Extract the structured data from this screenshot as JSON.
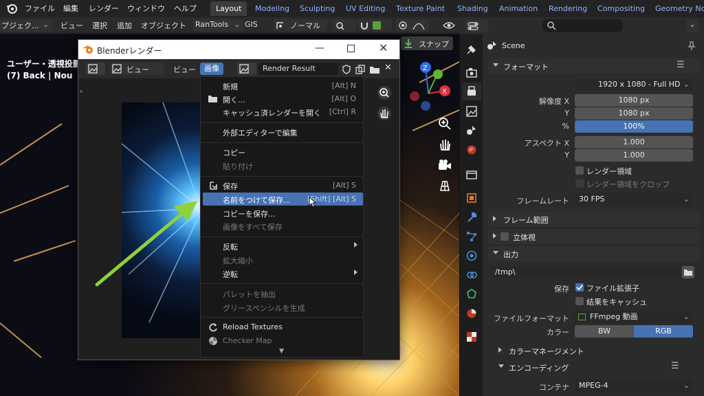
{
  "topbar": {
    "menus": [
      "ファイル",
      "編集",
      "レンダー",
      "ウィンドウ",
      "ヘルプ"
    ],
    "workspaces": [
      "Layout",
      "Modeling",
      "Sculpting",
      "UV Editing",
      "Texture Paint",
      "Shading",
      "Animation",
      "Rendering",
      "Compositing",
      "Geometry No"
    ],
    "active_workspace": "Layout"
  },
  "viewport_header": {
    "mode": "プジェク...",
    "menus": [
      "ビュー",
      "選択",
      "追加",
      "オブジェクト"
    ],
    "addon1": "RanTools",
    "addon2": "GIS",
    "orientation": "ノーマル",
    "snap": "スナップ"
  },
  "viewport": {
    "view_name": "ユーザー・透視投影",
    "object_info": "(7) Back | Nou"
  },
  "render_window": {
    "title": "Blenderレンダー",
    "view_menu": "ビュー",
    "view_label": "ビュー",
    "image_menu": "画像",
    "image_name": "Render Result"
  },
  "image_menu": {
    "items": [
      {
        "label": "新規",
        "shortcut": "[Alt] N"
      },
      {
        "label": "開く...",
        "shortcut": "[Alt] O"
      },
      {
        "label": "キャッシュ済レンダーを開く",
        "shortcut": "[Ctrl] R"
      },
      {
        "label": "外部エディターで編集",
        "shortcut": ""
      },
      {
        "label": "コピー",
        "shortcut": ""
      },
      {
        "label": "貼り付け",
        "shortcut": ""
      },
      {
        "label": "保存",
        "shortcut": "[Alt] S"
      },
      {
        "label": "名前をつけて保存...",
        "shortcut": "[Shift] [Alt] S"
      },
      {
        "label": "コピーを保存...",
        "shortcut": ""
      },
      {
        "label": "画像をすべて保存",
        "shortcut": ""
      },
      {
        "label": "反転",
        "shortcut": ""
      },
      {
        "label": "拡大縮小",
        "shortcut": ""
      },
      {
        "label": "逆転",
        "shortcut": ""
      },
      {
        "label": "パレットを抽出",
        "shortcut": ""
      },
      {
        "label": "グリースペンシルを生成",
        "shortcut": ""
      },
      {
        "label": "Reload Textures",
        "shortcut": ""
      },
      {
        "label": "Checker Map",
        "shortcut": ""
      }
    ]
  },
  "properties": {
    "scene_name": "Scene",
    "format": {
      "title": "フォーマット",
      "preset": "1920 x 1080 - Full HD",
      "res_x_label": "解像度 X",
      "res_x": "1080 px",
      "res_y_label": "Y",
      "res_y": "1080 px",
      "percent_label": "%",
      "percent": "100%",
      "aspect_x_label": "アスペクト X",
      "aspect_x": "1.000",
      "aspect_y_label": "Y",
      "aspect_y": "1.000",
      "render_region": "レンダー領域",
      "crop_region": "レンダー領域をクロップ",
      "framerate_label": "フレームレート",
      "framerate": "30 FPS"
    },
    "frame_range": "フレーム範囲",
    "stereo": "立体視",
    "output": {
      "title": "出力",
      "path": "/tmp\\",
      "save_label": "保存",
      "file_ext": "ファイル拡張子",
      "cache_result": "結果をキャッシュ",
      "file_format_label": "ファイルフォーマット",
      "file_format": "FFmpeg 動画",
      "color_label": "カラー",
      "color_bw": "BW",
      "color_rgb": "RGB",
      "color_management": "カラーマネージメント",
      "encoding": "エンコーディング",
      "container_label": "コンテナ",
      "container": "MPEG-4"
    }
  },
  "colors": {
    "accent": "#4772b3",
    "workspace_tab_text": "#8db4ff",
    "arrow": "#8fd13a"
  }
}
